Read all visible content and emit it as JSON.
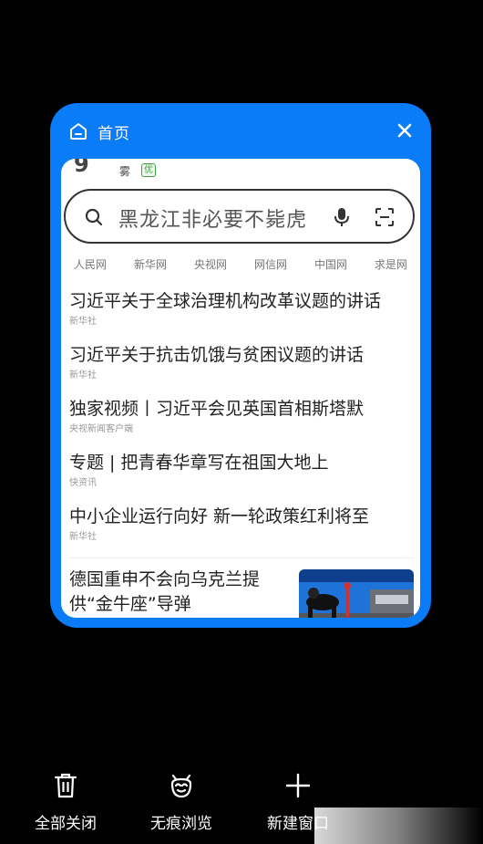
{
  "tab_card": {
    "title": "首页",
    "weather": {
      "temp": "9",
      "condition": "雾",
      "aqi": "优"
    },
    "search": {
      "query": "黑龙江非必要不毙虎"
    },
    "sources": [
      "人民网",
      "新华网",
      "央视网",
      "网信网",
      "中国网",
      "求是网"
    ],
    "news": [
      {
        "title": "习近平关于全球治理机构改革议题的讲话",
        "source": "新华社"
      },
      {
        "title": "习近平关于抗击饥饿与贫困议题的讲话",
        "source": "新华社"
      },
      {
        "title": "独家视频丨习近平会见英国首相斯塔默",
        "source": "央视新闻客户端"
      },
      {
        "title": "专题 | 把青春华章写在祖国大地上",
        "source": "快资讯"
      },
      {
        "title": "中小企业运行向好 新一轮政策红利将至",
        "source": "新华社"
      }
    ],
    "news_with_image": {
      "title": "德国重申不会向乌克兰提供“金牛座”导弹"
    }
  },
  "toolbar": {
    "close_all": "全部关闭",
    "incognito": "无痕浏览",
    "new_window": "新建窗口"
  },
  "colors": {
    "card_accent": "#0a7cf8",
    "background": "#000000"
  },
  "icons": [
    "home-icon",
    "close-icon",
    "search-icon",
    "mic-icon",
    "scan-icon",
    "trash-icon",
    "incognito-icon",
    "plus-icon"
  ]
}
